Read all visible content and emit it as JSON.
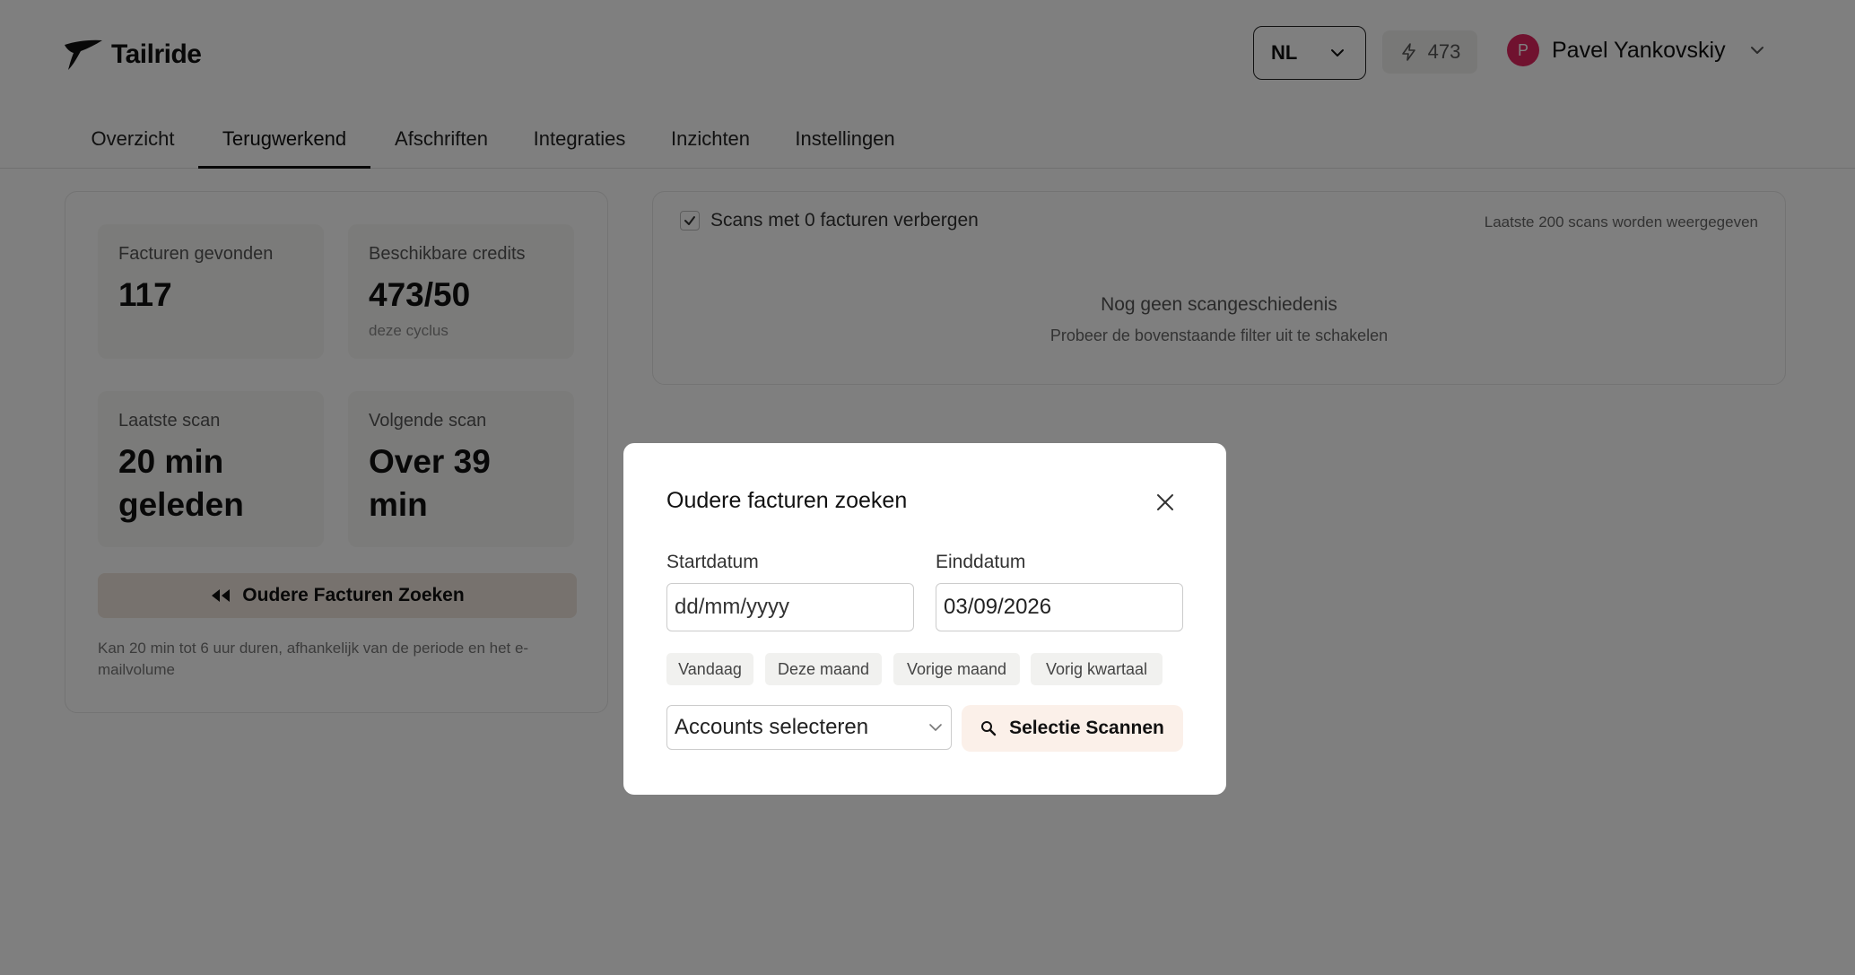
{
  "app": {
    "logo_text": "Tailride",
    "language": "NL",
    "credits_count": "473",
    "user": {
      "avatar_initial": "P",
      "name": "Pavel Yankovskiy"
    }
  },
  "tabs": [
    {
      "label": "Overzicht",
      "active": false
    },
    {
      "label": "Terugwerkend",
      "active": true
    },
    {
      "label": "Afschriften",
      "active": false
    },
    {
      "label": "Integraties",
      "active": false
    },
    {
      "label": "Inzichten",
      "active": false
    },
    {
      "label": "Instellingen",
      "active": false
    }
  ],
  "stats": {
    "invoices_found": {
      "label": "Facturen gevonden",
      "value": "117"
    },
    "credits": {
      "label": "Beschikbare credits",
      "value": "473/50",
      "sub": "deze cyclus"
    },
    "last_scan": {
      "label": "Laatste scan",
      "value": "20 min geleden"
    },
    "next_scan": {
      "label": "Volgende scan",
      "value": "Over 39 min"
    }
  },
  "older_invoices_button": "Oudere Facturen Zoeken",
  "duration_hint": "Kan 20 min tot 6 uur duren, afhankelijk van de periode en het e-mailvolume",
  "history": {
    "hide_empty_label": "Scans met 0 facturen verbergen",
    "hide_empty_checked": true,
    "last_scans_note": "Laatste 200 scans worden weergegeven",
    "empty_title": "Nog geen scangeschiedenis",
    "empty_subtitle": "Probeer de bovenstaande filter uit te schakelen"
  },
  "modal": {
    "title": "Oudere facturen zoeken",
    "start_label": "Startdatum",
    "start_placeholder": "dd/mm/yyyy",
    "end_label": "Einddatum",
    "end_value": "03/09/2026",
    "quick_ranges": [
      "Vandaag",
      "Deze maand",
      "Vorige maand",
      "Vorig kwartaal"
    ],
    "accounts_placeholder": "Accounts selecteren",
    "scan_button": "Selectie Scannen"
  }
}
